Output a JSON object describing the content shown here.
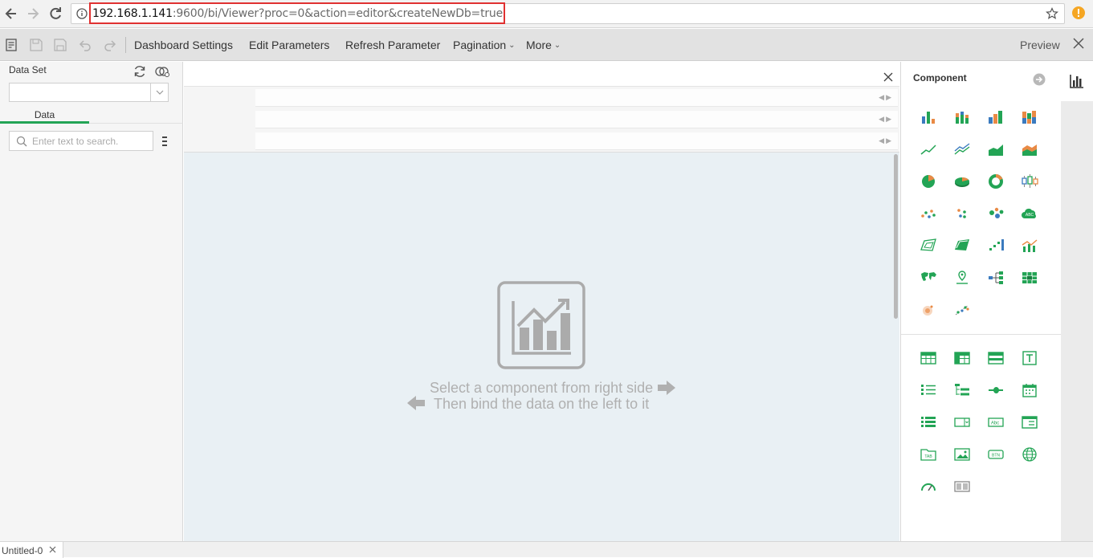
{
  "browser": {
    "url_host": "192.168.1.141",
    "url_rest": ":9600/bi/Viewer?proc=0&action=editor&createNewDb=true"
  },
  "toolbar": {
    "dashboard_settings": "Dashboard Settings",
    "edit_parameters": "Edit Parameters",
    "refresh_parameter": "Refresh Parameter",
    "pagination": "Pagination",
    "more": "More",
    "preview": "Preview"
  },
  "left_panel": {
    "dataset_label": "Data Set",
    "tab_data": "Data",
    "search_placeholder": "Enter text to search."
  },
  "canvas": {
    "hint_line1": "Select a component from right side",
    "hint_line2": "Then bind the data on the left to it"
  },
  "right_panel": {
    "title": "Component",
    "chart_icons": [
      "bar-chart-icon",
      "stacked-bar-chart-icon",
      "grouped-bar-chart-icon",
      "stacked-column-chart-icon",
      "line-chart-icon",
      "multi-line-chart-icon",
      "area-chart-icon",
      "stacked-area-chart-icon",
      "pie-chart-icon",
      "3d-pie-chart-icon",
      "donut-chart-icon",
      "box-plot-icon",
      "scatter-chart-icon",
      "dot-plot-icon",
      "bubble-chart-icon",
      "word-cloud-icon",
      "radar-chart-icon",
      "filled-radar-chart-icon",
      "step-chart-icon",
      "combo-chart-icon",
      "world-map-icon",
      "location-map-icon",
      "tree-chart-icon",
      "heatmap-table-icon",
      "heat-density-icon",
      "scatter-trend-icon"
    ],
    "widget_icons": [
      "table-icon",
      "crosstab-icon",
      "freestyle-table-icon",
      "text-box-icon",
      "list-filter-icon",
      "tree-filter-icon",
      "slider-icon",
      "calendar-icon",
      "list-icon",
      "dropdown-icon",
      "text-input-icon",
      "form-icon",
      "tab-container-icon",
      "image-icon",
      "button-icon",
      "web-page-icon",
      "gauge-icon",
      "container-icon"
    ],
    "accent_green": "#23a455",
    "accent_orange": "#e98a45",
    "accent_blue": "#3b7bbf"
  },
  "bottom": {
    "tab_label": "Untitled-0"
  }
}
